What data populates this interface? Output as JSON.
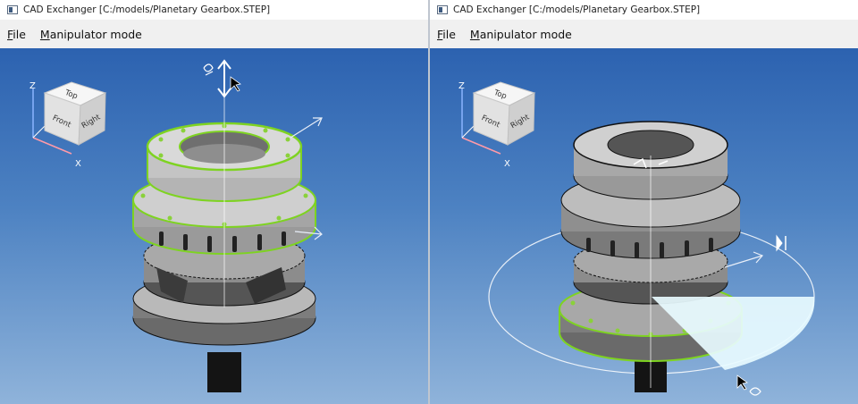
{
  "windows": [
    {
      "title": "CAD Exchanger [C:/models/Planetary Gearbox.STEP]",
      "menu": [
        "File",
        "Manipulator mode"
      ],
      "mnemonics": [
        "F",
        "M"
      ],
      "viewcube": {
        "faces": [
          "Top",
          "Front",
          "Right"
        ],
        "axes": [
          "Z",
          "X"
        ]
      }
    },
    {
      "title": "CAD Exchanger [C:/models/Planetary Gearbox.STEP]",
      "menu": [
        "File",
        "Manipulator mode"
      ],
      "mnemonics": [
        "F",
        "M"
      ],
      "viewcube": {
        "faces": [
          "Top",
          "Front",
          "Right"
        ],
        "axes": [
          "Z",
          "X"
        ]
      }
    }
  ],
  "colors": {
    "selection": "#7ed321",
    "viewport_top": "#2c62b0",
    "viewport_bottom": "#8fb3da"
  }
}
